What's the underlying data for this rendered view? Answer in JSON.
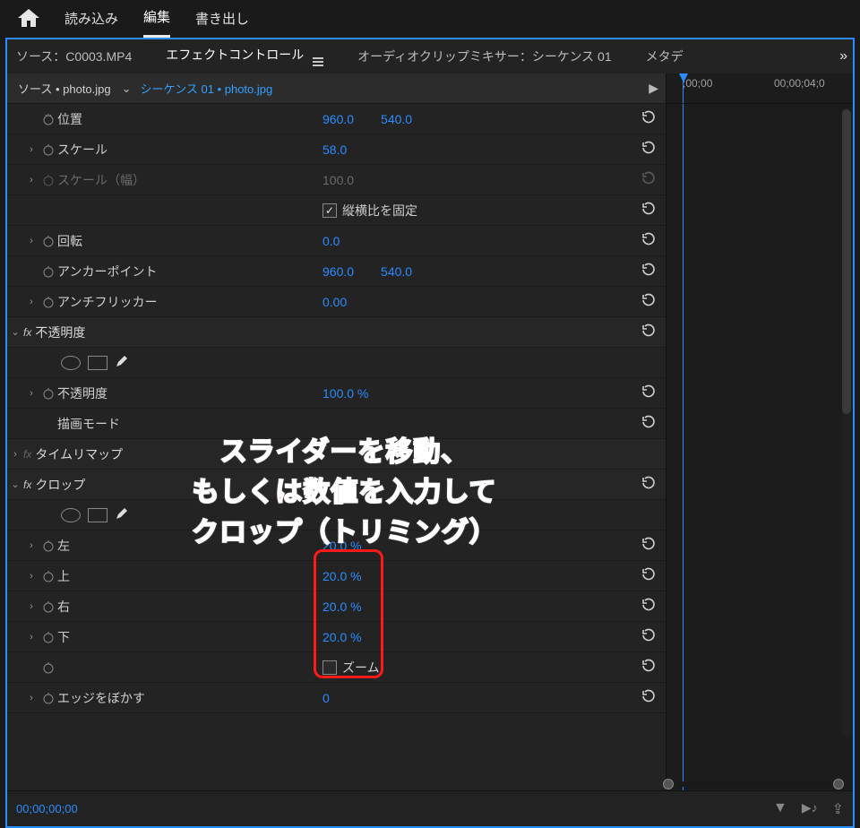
{
  "topnav": {
    "tabs": [
      "読み込み",
      "編集",
      "書き出し"
    ],
    "active": 1
  },
  "subtabs": {
    "items": [
      "ソース：C0003.MP4",
      "エフェクトコントロール",
      "オーディオクリップミキサー：シーケンス 01",
      "メタデ"
    ],
    "active": 1
  },
  "source": {
    "clip": "ソース • photo.jpg",
    "sequence": "シーケンス 01 • photo.jpg"
  },
  "ruler": {
    "marks": [
      ";00;00",
      "00;00;04;0"
    ]
  },
  "motion": {
    "position": {
      "label": "位置",
      "x": "960.0",
      "y": "540.0"
    },
    "scale": {
      "label": "スケール",
      "value": "58.0"
    },
    "scale_w": {
      "label": "スケール（幅）",
      "value": "100.0"
    },
    "uniform": {
      "label": "縦横比を固定",
      "checked": true
    },
    "rotation": {
      "label": "回転",
      "value": "0.0"
    },
    "anchor": {
      "label": "アンカーポイント",
      "x": "960.0",
      "y": "540.0"
    },
    "antiflicker": {
      "label": "アンチフリッカー",
      "value": "0.00"
    }
  },
  "opacity": {
    "section": "不透明度",
    "amount": {
      "label": "不透明度",
      "value": "100.0 %"
    },
    "blend": {
      "label": "描画モード"
    }
  },
  "timeremap": {
    "section": "タイムリマップ"
  },
  "crop": {
    "section": "クロップ",
    "left": {
      "label": "左",
      "value": "20.0 %"
    },
    "top": {
      "label": "上",
      "value": "20.0 %"
    },
    "right": {
      "label": "右",
      "value": "20.0 %"
    },
    "bottom": {
      "label": "下",
      "value": "20.0 %"
    },
    "zoom": {
      "label": "ズーム",
      "checked": false
    },
    "edge": {
      "label": "エッジをぼかす",
      "value": "0"
    }
  },
  "footer": {
    "timecode": "00;00;00;00"
  },
  "annotation": {
    "l1": "スライダーを移動、",
    "l2": "もしくは数値を入力して",
    "l3": "クロップ（トリミング）"
  }
}
